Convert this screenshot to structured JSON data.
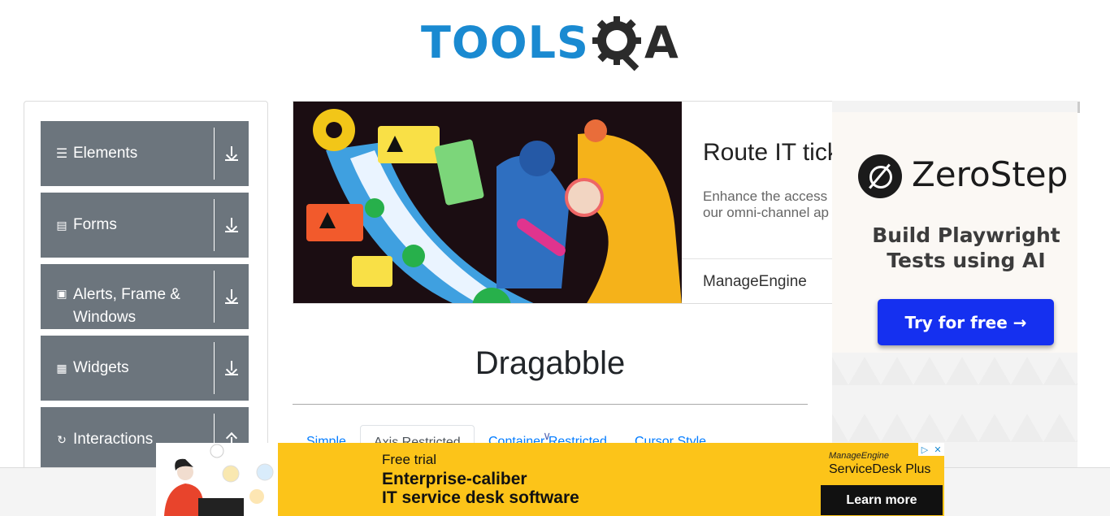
{
  "header": {
    "logo_text": "TOOLS",
    "logo_qa": "A"
  },
  "sidebar": {
    "groups": [
      {
        "label": "Elements",
        "icon": "menu-icon",
        "toggle_icon": "download-icon"
      },
      {
        "label": "Forms",
        "icon": "document-icon",
        "toggle_icon": "download-icon"
      },
      {
        "label": "Alerts, Frame & Windows",
        "icon": "window-icon",
        "toggle_icon": "download-icon"
      },
      {
        "label": "Widgets",
        "icon": "widgets-icon",
        "toggle_icon": "download-icon"
      },
      {
        "label": "Interactions",
        "icon": "interactions-icon",
        "toggle_icon": "upload-icon"
      }
    ]
  },
  "ad_banner": {
    "title": "Route IT tick",
    "description_line1": "Enhance the access",
    "description_line2": "our omni-channel ap",
    "brand": "ManageEngine"
  },
  "side_ad": {
    "brand": "ZeroStep",
    "tagline": "Build Playwright Tests using AI",
    "cta": "Try for free →"
  },
  "main": {
    "title": "Dragabble",
    "tabs": [
      {
        "label": "Simple",
        "active": false
      },
      {
        "label": "Axis Restricted",
        "active": true
      },
      {
        "label": "Container Restricted",
        "active": false
      },
      {
        "label": "Cursor Style",
        "active": false
      }
    ]
  },
  "bottom_ad": {
    "free_trial": "Free trial",
    "headline_line1": "Enterprise-caliber",
    "headline_line2": "IT service desk software",
    "brand_small": "ManageEngine",
    "brand_product": "ServiceDesk Plus",
    "cta": "Learn more",
    "info_glyph": "▷",
    "close_glyph": "✕"
  },
  "colors": {
    "sidebar_group_bg": "#6c757d",
    "logo_blue": "#1a8ad1",
    "link": "#007bff",
    "bottom_ad_bg": "#fcc419",
    "zerostep_button": "#1530f0"
  }
}
